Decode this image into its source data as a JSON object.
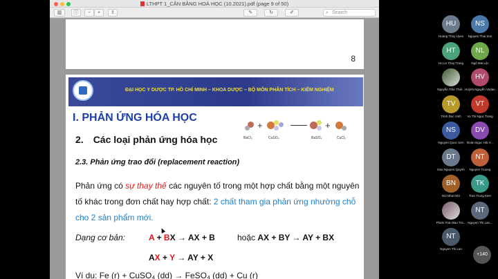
{
  "window": {
    "title": "LTHPT 1_CÂN BẰNG HOÁ HỌC (10.2021).pdf (page 9 of 50)",
    "search_placeholder": "Search"
  },
  "pages": {
    "prev_page_number": "8"
  },
  "slide": {
    "banner": "ĐẠI HỌC Y DƯỢC TP. HỒ CHÍ MINH – KHOA DƯỢC – BỘ MÔN PHÂN TÍCH – KIỂM NGHIỆM",
    "title": "I. PHẢN ỨNG HÓA HỌC",
    "subtitle_number": "2.",
    "subtitle": "Các loại phản ứng hóa học",
    "section": "2.3. Phản ứng trao đổi (replacement reaction)",
    "para_part1": "Phản ứng có ",
    "para_highlight": "sự thay thế",
    "para_part2": " các nguyên tố trong một hợp chất bằng một nguyên tố khác trong đơn chất hay hợp chất: ",
    "para_blue": "2 chất tham gia phản ứng nhường chỗ cho 2 sản phẩm mới.",
    "form_label": "Dạng cơ bản:",
    "f1_A": "A",
    "f1_plus": " + ",
    "f1_B": "B",
    "f1_rest": "X → AX + B",
    "f2_or": "hoặc ",
    "f2_rest": "AX + BY → AY + BX",
    "f3_A": "A",
    "f3_X": "X",
    "f3_plus": " + ",
    "f3_Y": "Y",
    "f3_rest": " → AY + X",
    "example": "Ví dụ: Fe (r) + CuSO₄ (dd) → FeSO₄ (dd) + Cu (r)",
    "reaction_labels": [
      "BaCl₂",
      "CuSO₄",
      "BaSO₄",
      "CuCl₂"
    ]
  },
  "participants": [
    {
      "initials": "HU",
      "name": "Hoang Thuy Uyen",
      "color": "#6b7b8b"
    },
    {
      "initials": "NS",
      "name": "Nguyen Thai Son",
      "color": "#4a78a8"
    },
    {
      "initials": "HT",
      "name": "Ho Le Thuy Trang",
      "color": "#4aa37b"
    },
    {
      "initials": "NL",
      "name": "Ngô Mai Lộc",
      "color": "#6fa84a"
    },
    {
      "initials": "",
      "name": "Nguyễn Trần Thiệ...",
      "color": "#3b5a2e"
    },
    {
      "initials": "HV",
      "name": "Huỳnh Nguyễn Vedan...",
      "color": "#b04a6e"
    },
    {
      "initials": "TV",
      "name": "Trinh Duc Vinh",
      "color": "#b89a2a"
    },
    {
      "initials": "VT",
      "name": "Vo Thi Ngoc Trang",
      "color": "#c0392b"
    },
    {
      "initials": "NS",
      "name": "Nguyen Quoc Sơn",
      "color": "#3b5aa0"
    },
    {
      "initials": "DV",
      "name": "Đoàn Ngọc Hải V...",
      "color": "#8a4ab0"
    },
    {
      "initials": "DT",
      "name": "Dao Nguyen Quynh",
      "color": "#6a7a8a"
    },
    {
      "initials": "NT",
      "name": "Nguyen Truong",
      "color": "#c0603a"
    },
    {
      "initials": "BN",
      "name": "Bùi Nhựt Nhi",
      "color": "#a0602a"
    },
    {
      "initials": "TK",
      "name": "Tran Trung Kien",
      "color": "#3a9a8a"
    },
    {
      "initials": "",
      "name": "Pham Tran Bao Tra...",
      "color": "#7a5a6a"
    },
    {
      "initials": "NT",
      "name": "Nguyen Thi Lan...",
      "color": "#5a6a7a"
    },
    {
      "initials": "NT",
      "name": "Nguyen Thi Lan",
      "color": "#4a5a6a"
    }
  ],
  "participants_more": "+140"
}
